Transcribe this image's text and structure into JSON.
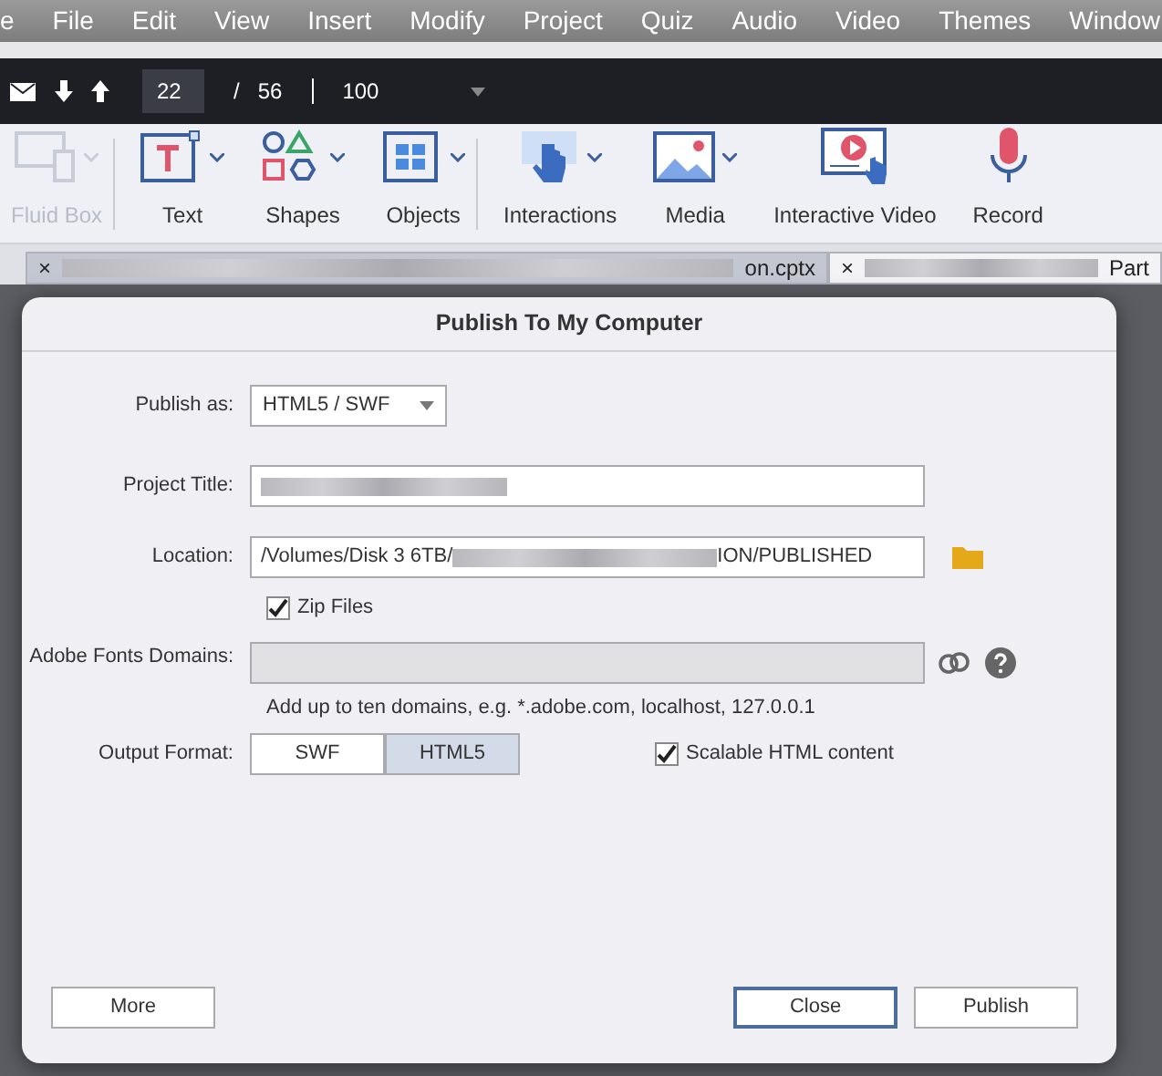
{
  "menu_bar": [
    "e",
    "File",
    "Edit",
    "View",
    "Insert",
    "Modify",
    "Project",
    "Quiz",
    "Audio",
    "Video",
    "Themes",
    "Window"
  ],
  "toolbar": {
    "current_slide": "22",
    "separator": "/",
    "total_slides": "56",
    "zoom": "100"
  },
  "ribbon": [
    {
      "kind": "fluid",
      "label": "Fluid Box",
      "disabled": true,
      "has_menu": true
    },
    {
      "kind": "text",
      "label": "Text",
      "disabled": false,
      "has_menu": true
    },
    {
      "kind": "shapes",
      "label": "Shapes",
      "disabled": false,
      "has_menu": true
    },
    {
      "kind": "objects",
      "label": "Objects",
      "disabled": false,
      "has_menu": true
    },
    {
      "kind": "interactions",
      "label": "Interactions",
      "disabled": false,
      "has_menu": true
    },
    {
      "kind": "media",
      "label": "Media",
      "disabled": false,
      "has_menu": true
    },
    {
      "kind": "video",
      "label": "Interactive Video",
      "disabled": false,
      "has_menu": false
    },
    {
      "kind": "record",
      "label": "Record",
      "disabled": false,
      "has_menu": false
    }
  ],
  "document_tabs": [
    {
      "close": "×",
      "title": "on.cptx",
      "selected": true
    },
    {
      "close": "×",
      "title": "Part",
      "selected": false
    }
  ],
  "dialog": {
    "title": "Publish To My Computer",
    "publish_as": {
      "label": "Publish as:",
      "value": "HTML5  /  SWF"
    },
    "project_title": {
      "label": "Project Title:"
    },
    "location": {
      "label": "Location:",
      "value_start": "/Volumes/Disk 3 6TB/",
      "value_end": "ION/PUBLISHED"
    },
    "zip_files": {
      "label": "Zip Files",
      "checked": true
    },
    "fonts_domains": {
      "label": "Adobe Fonts Domains:",
      "hint": "Add up to ten domains, e.g. *.adobe.com, localhost, 127.0.0.1"
    },
    "output_format": {
      "label": "Output Format:",
      "options": [
        {
          "label": "SWF",
          "selected": false
        },
        {
          "label": "HTML5",
          "selected": true
        }
      ]
    },
    "scalable": {
      "label": "Scalable HTML content",
      "checked": true
    },
    "buttons": [
      {
        "label": "More",
        "default": false
      },
      {
        "label": "Close",
        "default": true
      },
      {
        "label": "Publish",
        "default": false
      }
    ]
  }
}
